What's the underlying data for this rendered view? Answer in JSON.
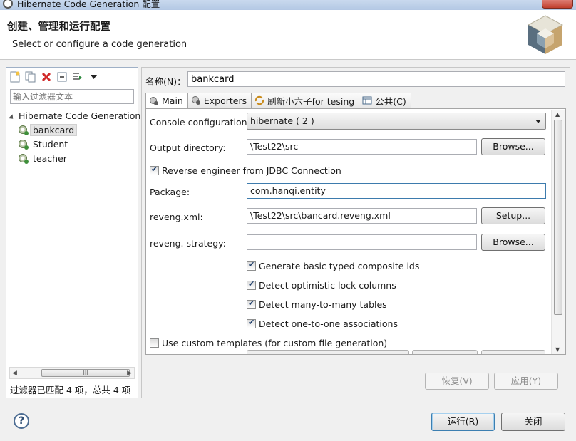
{
  "window": {
    "title": "Hibernate Code Generation 配置"
  },
  "header": {
    "title": "创建、管理和运行配置",
    "subtitle": "Select or configure a code generation"
  },
  "left_panel": {
    "filter_placeholder": "输入过滤器文本",
    "tree": {
      "root": "Hibernate Code Generation",
      "items": [
        {
          "label": "bankcard",
          "selected": true
        },
        {
          "label": "Student"
        },
        {
          "label": "teacher"
        }
      ]
    },
    "scroll_thumb_label": "III",
    "status": "过滤器已匹配 4 项，总共 4 项"
  },
  "name_label": "名称(N)：",
  "name_value": "bankcard",
  "tabs": [
    {
      "label": "Main",
      "active": true,
      "icon": "hibernate-icon"
    },
    {
      "label": "Exporters",
      "icon": "hibernate-icon"
    },
    {
      "label": "刷新小六子for tesing",
      "icon": "refresh-icon"
    },
    {
      "label": "公共(C)",
      "icon": "table-icon"
    }
  ],
  "main": {
    "console_configuration": {
      "label": "Console configuration:",
      "value": "hibernate ( 2 )"
    },
    "output_directory": {
      "label": "Output directory:",
      "value": "\\Test22\\src",
      "button": "Browse..."
    },
    "reverse_engineer": {
      "label": "Reverse engineer from JDBC Connection",
      "checked": true
    },
    "package": {
      "label": "Package:",
      "value": "com.hanqi.entity"
    },
    "reveng_xml": {
      "label": "reveng.xml:",
      "value": "\\Test22\\src\\bancard.reveng.xml",
      "button": "Setup..."
    },
    "reveng_strategy": {
      "label": "reveng. strategy:",
      "value": "",
      "button": "Browse..."
    },
    "options": [
      {
        "label": "Generate basic typed composite ids",
        "checked": true
      },
      {
        "label": "Detect optimistic lock columns",
        "checked": true
      },
      {
        "label": "Detect many-to-many tables",
        "checked": true
      },
      {
        "label": "Detect one-to-one associations",
        "checked": true
      }
    ],
    "custom_templates": {
      "label": "Use custom templates (for custom file generation)",
      "checked": false
    }
  },
  "actions": {
    "revert": "恢复(V)",
    "apply": "应用(Y)",
    "run": "运行(R)",
    "close": "关闭"
  },
  "help_icon_glyph": "?",
  "colors": {
    "accent": "#3c7fb1",
    "selection": "#e5e5e5"
  }
}
